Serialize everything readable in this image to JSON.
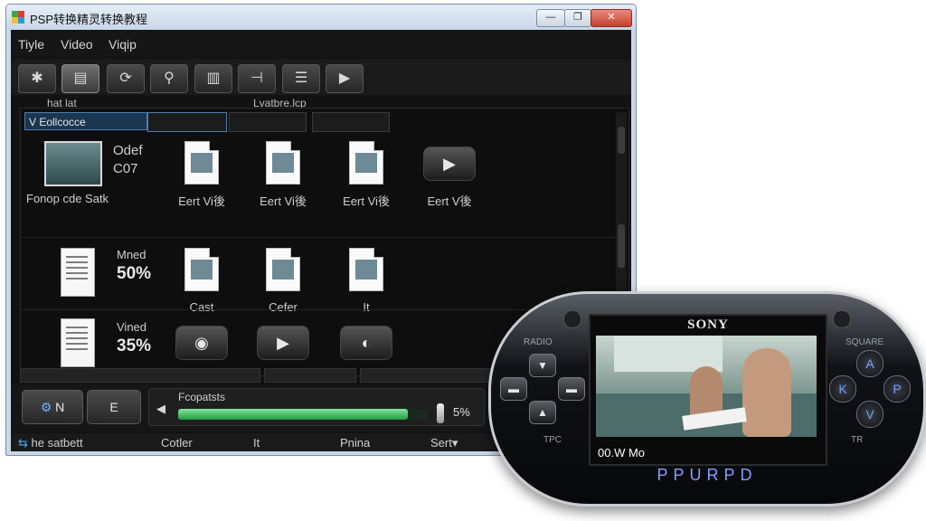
{
  "window": {
    "title": "PSP转换精灵转换教程",
    "controls": {
      "minimize": "—",
      "maximize": "❐",
      "close": "✕"
    }
  },
  "menu": [
    "Tiyle",
    "Video",
    "Viqip"
  ],
  "toolbar": [
    {
      "icon": "asterisk-icon",
      "glyph": "✱"
    },
    {
      "icon": "document-icon",
      "glyph": "▤"
    },
    {
      "icon": "refresh-search-icon",
      "glyph": "⟳"
    },
    {
      "icon": "search-icon",
      "glyph": "⚲"
    },
    {
      "icon": "bars-icon",
      "glyph": "▥"
    },
    {
      "icon": "split-icon",
      "glyph": "⊣"
    },
    {
      "icon": "stack-icon",
      "glyph": "☰"
    },
    {
      "icon": "arrow-right-icon",
      "glyph": "▶"
    }
  ],
  "headers": {
    "left": "hat lat",
    "right": "Lvatbre.lcp"
  },
  "category": {
    "selected": "V Eollcocce"
  },
  "rows": [
    {
      "items": [
        {
          "type": "thumb",
          "label": "Fonop cde Satk"
        },
        {
          "type": "doc",
          "label": "Eert Vi後"
        },
        {
          "type": "doc",
          "label": "Eert Vi後"
        },
        {
          "type": "doc",
          "label": "Eert Vi後"
        },
        {
          "type": "media",
          "glyph": "▶",
          "label": "Eert V後"
        }
      ],
      "side": {
        "line1": "Odef",
        "line2": "C07"
      }
    },
    {
      "items": [
        {
          "type": "doc",
          "label": "Cast"
        },
        {
          "type": "doc",
          "label": "Cefer"
        },
        {
          "type": "doc",
          "label": "It"
        }
      ],
      "side": {
        "mode": "Mned",
        "percent": "50%"
      }
    },
    {
      "items": [
        {
          "type": "media",
          "glyph": "◉"
        },
        {
          "type": "media",
          "glyph": "▶"
        },
        {
          "type": "media",
          "glyph": "◐"
        }
      ],
      "side": {
        "mode": "Vined",
        "percent": "35%"
      }
    }
  ],
  "bottom": {
    "btn1": "N",
    "btn1_icon": "gear-icon",
    "btn2": "E",
    "progress_label": "Fcopatsts",
    "progress_percent": "5%",
    "progress_value": 0.92
  },
  "status": {
    "item1": "he satbett",
    "item2": "Cotler",
    "item3": "It",
    "item4": "Pnina",
    "item5": "Sert▾"
  },
  "psp": {
    "brand": "SONY",
    "caption": "00.W Mo",
    "logo": "PPURPD",
    "labels": {
      "tl": "RADIO",
      "tr": "SQUARE",
      "bl": "TPC",
      "br": "TR"
    },
    "dpad": {
      "up": "▲",
      "down": "▼",
      "left": "▬",
      "right": "▬"
    },
    "face": {
      "top": "A",
      "left": "K",
      "right": "P",
      "bottom": "V"
    }
  }
}
